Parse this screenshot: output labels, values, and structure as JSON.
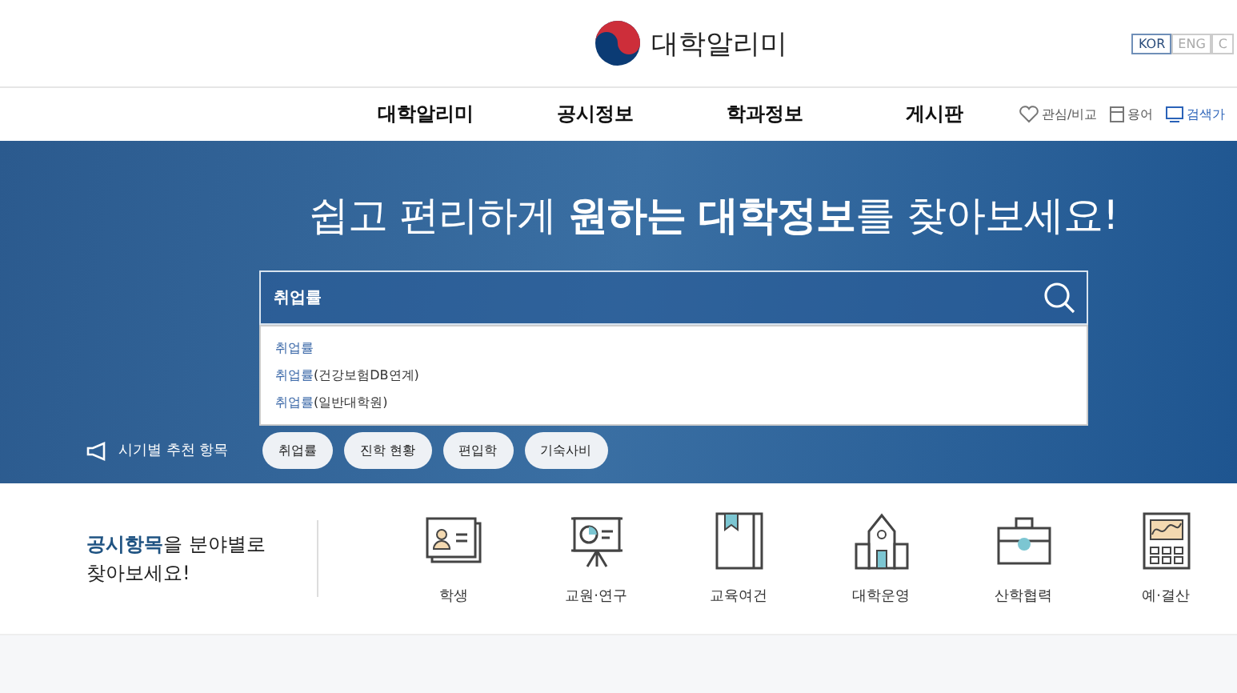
{
  "header": {
    "logo_text": "대학알리미",
    "languages": [
      {
        "label": "KOR",
        "selected": true
      },
      {
        "label": "ENG",
        "selected": false
      },
      {
        "label": "C",
        "selected": false
      }
    ]
  },
  "nav": {
    "items": [
      "대학알리미",
      "공시정보",
      "학과정보",
      "게시판"
    ],
    "utilities": [
      {
        "kind": "heart",
        "label": "관심/비교"
      },
      {
        "kind": "book",
        "label": "용어"
      },
      {
        "kind": "monitor",
        "label": "검색가"
      }
    ]
  },
  "hero": {
    "title_parts": [
      "쉽고 편리하게 ",
      "원하는 대학정보",
      "를 찾아보세요!"
    ],
    "search": {
      "value": "취업률"
    },
    "suggestions": [
      {
        "match": "취업률"
      },
      {
        "match": "취업률",
        "rest": "(건강보험DB연계)"
      },
      {
        "match": "취업률",
        "rest": "(일반대학원)"
      }
    ],
    "recommend_label": "시기별 추천 항목",
    "recommend_tags": [
      "취업률",
      "진학 현황",
      "편입학",
      "기숙사비"
    ]
  },
  "categories": {
    "intro_strong": "공시항목",
    "intro_rest": "을 분야별로",
    "intro_line2": "찾아보세요!",
    "items": [
      {
        "kind": "student",
        "label": "학생"
      },
      {
        "kind": "teacher",
        "label": "교원·연구"
      },
      {
        "kind": "book",
        "label": "교육여건"
      },
      {
        "kind": "building",
        "label": "대학운영"
      },
      {
        "kind": "briefcase",
        "label": "산학협력"
      },
      {
        "kind": "calculator",
        "label": "예·결산"
      }
    ]
  }
}
